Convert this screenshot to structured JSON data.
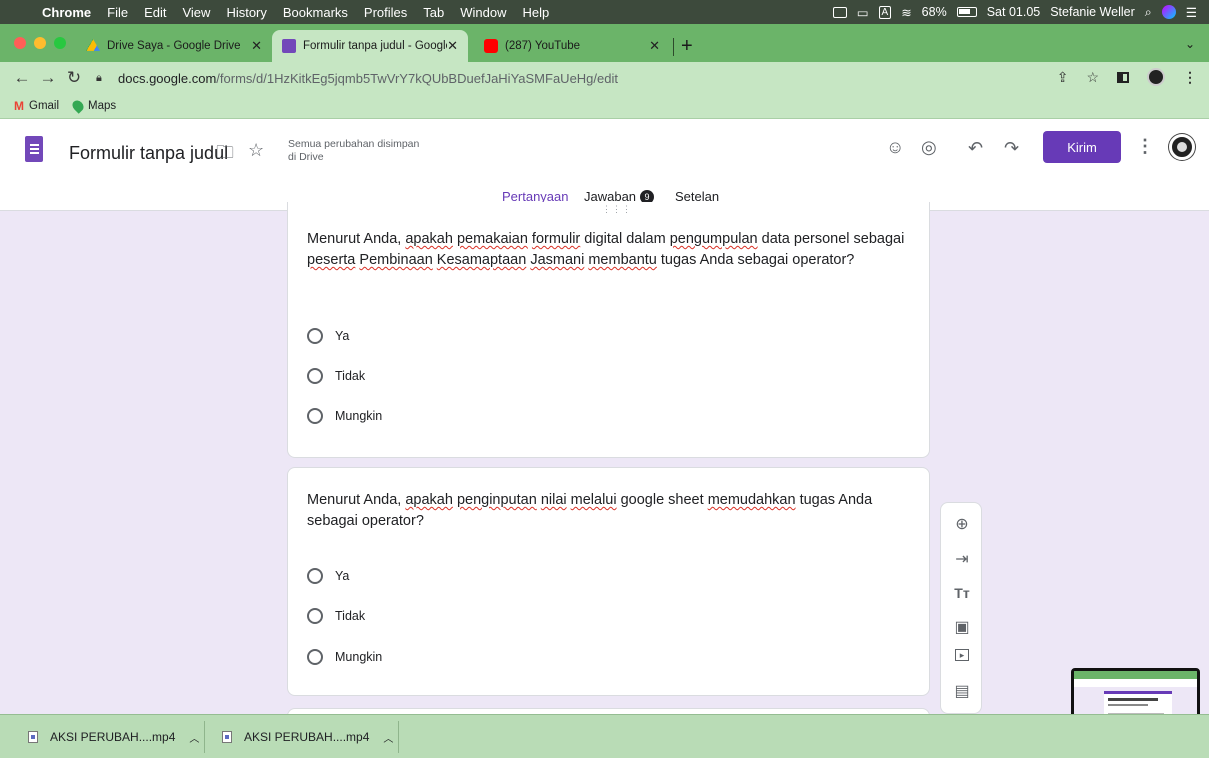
{
  "menubar": {
    "apple": "",
    "app": "Chrome",
    "items": [
      "File",
      "Edit",
      "View",
      "History",
      "Bookmarks",
      "Profiles",
      "Tab",
      "Window",
      "Help"
    ],
    "input_source": "A",
    "battery": "68%",
    "clock": "Sat 01.05",
    "user": "Stefanie Weller"
  },
  "tabs": [
    {
      "title": "Drive Saya - Google Drive",
      "close": "✕"
    },
    {
      "title": "Formulir tanpa judul - Google F",
      "close": "✕"
    },
    {
      "title": "(287) YouTube",
      "close": "✕"
    }
  ],
  "newtab": "+",
  "address": {
    "host": "docs.google.com",
    "path": "/forms/d/1HzKitkEg5jqmb5TwVrY7kQUbBDuefJaHiYaSMFaUeHg/edit"
  },
  "bookmarks": [
    "Gmail",
    "Maps"
  ],
  "form": {
    "title": "Formulir tanpa judul",
    "save_status_line1": "Semua perubahan disimpan",
    "save_status_line2": "di Drive",
    "send_label": "Kirim",
    "tabs": {
      "questions": "Pertanyaan",
      "responses": "Jawaban",
      "responses_count": "9",
      "settings": "Setelan"
    }
  },
  "questions": [
    {
      "parts": [
        {
          "t": "Menurut Anda, ",
          "sp": false
        },
        {
          "t": "apakah",
          "sp": true
        },
        {
          "t": " ",
          "sp": false
        },
        {
          "t": "pemakaian",
          "sp": true
        },
        {
          "t": " ",
          "sp": false
        },
        {
          "t": "formulir",
          "sp": true
        },
        {
          "t": " digital dalam ",
          "sp": false
        },
        {
          "t": "pengumpulan",
          "sp": true
        },
        {
          "t": " data personel sebagai ",
          "sp": false
        },
        {
          "t": "peserta",
          "sp": true
        },
        {
          "t": " ",
          "sp": false
        },
        {
          "t": "Pembinaan",
          "sp": true
        },
        {
          "t": " ",
          "sp": false
        },
        {
          "t": "Kesamaptaan",
          "sp": true
        },
        {
          "t": " ",
          "sp": false
        },
        {
          "t": "Jasmani",
          "sp": true
        },
        {
          "t": " ",
          "sp": false
        },
        {
          "t": "membantu",
          "sp": true
        },
        {
          "t": " tugas Anda sebagai operator?",
          "sp": false
        }
      ],
      "options": [
        "Ya",
        "Tidak",
        "Mungkin"
      ]
    },
    {
      "parts": [
        {
          "t": "Menurut Anda, ",
          "sp": false
        },
        {
          "t": "apakah",
          "sp": true
        },
        {
          "t": " ",
          "sp": false
        },
        {
          "t": "penginputan",
          "sp": true
        },
        {
          "t": " ",
          "sp": false
        },
        {
          "t": "nilai",
          "sp": true
        },
        {
          "t": " ",
          "sp": false
        },
        {
          "t": "melalui",
          "sp": true
        },
        {
          "t": " google sheet ",
          "sp": false
        },
        {
          "t": "memudahkan",
          "sp": true
        },
        {
          "t": " tugas Anda sebagai operator?",
          "sp": false
        }
      ],
      "options": [
        "Ya",
        "Tidak",
        "Mungkin"
      ]
    }
  ],
  "toolbar_icons": [
    "add-question-icon",
    "import-questions-icon",
    "add-title-icon",
    "add-image-icon",
    "add-video-icon",
    "add-section-icon"
  ],
  "toolbar_glyphs": [
    "⊕",
    "⇥",
    "Tт",
    "▣",
    "▸",
    "▤"
  ],
  "downloads": [
    {
      "name": "AKSI PERUBAH....mp4"
    },
    {
      "name": "AKSI PERUBAH....mp4"
    }
  ],
  "colors": {
    "accent": "#673ab7",
    "menubar": "#3d4a3c",
    "tabstrip": "#6bb469",
    "toolbar_bg": "#c6e6c3",
    "page_bg": "#ede7f6"
  }
}
